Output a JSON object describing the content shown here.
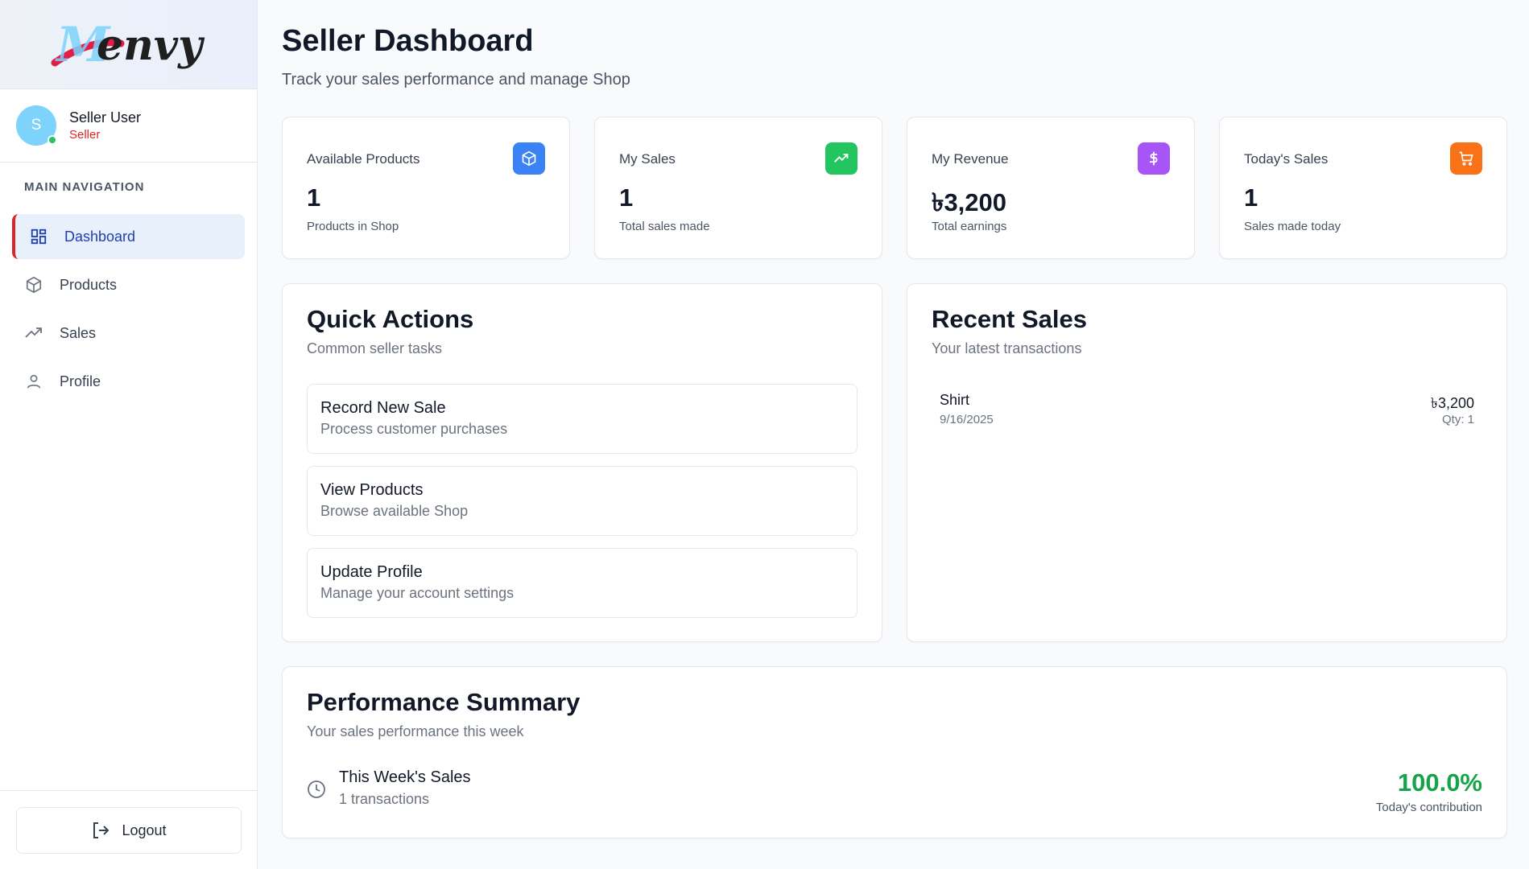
{
  "brand": {
    "logo_text": "Menvy"
  },
  "user": {
    "initial": "S",
    "name": "Seller User",
    "role": "Seller"
  },
  "nav": {
    "heading": "MAIN NAVIGATION",
    "items": [
      {
        "label": "Dashboard",
        "icon": "dashboard-grid-icon",
        "active": true
      },
      {
        "label": "Products",
        "icon": "package-icon",
        "active": false
      },
      {
        "label": "Sales",
        "icon": "trending-up-icon",
        "active": false
      },
      {
        "label": "Profile",
        "icon": "user-icon",
        "active": false
      }
    ],
    "logout_label": "Logout"
  },
  "header": {
    "title": "Seller Dashboard",
    "subtitle": "Track your sales performance and manage Shop"
  },
  "stats": [
    {
      "label": "Available Products",
      "value": "1",
      "note": "Products in Shop",
      "icon": "package-icon",
      "color": "#3b82f6"
    },
    {
      "label": "My Sales",
      "value": "1",
      "note": "Total sales made",
      "icon": "trending-up-icon",
      "color": "#22c55e"
    },
    {
      "label": "My Revenue",
      "value": "৳3,200",
      "note": "Total earnings",
      "icon": "dollar-icon",
      "color": "#a855f7"
    },
    {
      "label": "Today's Sales",
      "value": "1",
      "note": "Sales made today",
      "icon": "cart-icon",
      "color": "#f97316"
    }
  ],
  "quick_actions": {
    "title": "Quick Actions",
    "subtitle": "Common seller tasks",
    "items": [
      {
        "title": "Record New Sale",
        "subtitle": "Process customer purchases"
      },
      {
        "title": "View Products",
        "subtitle": "Browse available Shop"
      },
      {
        "title": "Update Profile",
        "subtitle": "Manage your account settings"
      }
    ]
  },
  "recent_sales": {
    "title": "Recent Sales",
    "subtitle": "Your latest transactions",
    "items": [
      {
        "name": "Shirt",
        "date": "9/16/2025",
        "amount": "৳3,200",
        "qty": "Qty: 1"
      }
    ]
  },
  "performance": {
    "title": "Performance Summary",
    "subtitle": "Your sales performance this week",
    "row_title": "This Week's Sales",
    "row_sub": "1 transactions",
    "percent": "100.0%",
    "percent_note": "Today's contribution"
  }
}
